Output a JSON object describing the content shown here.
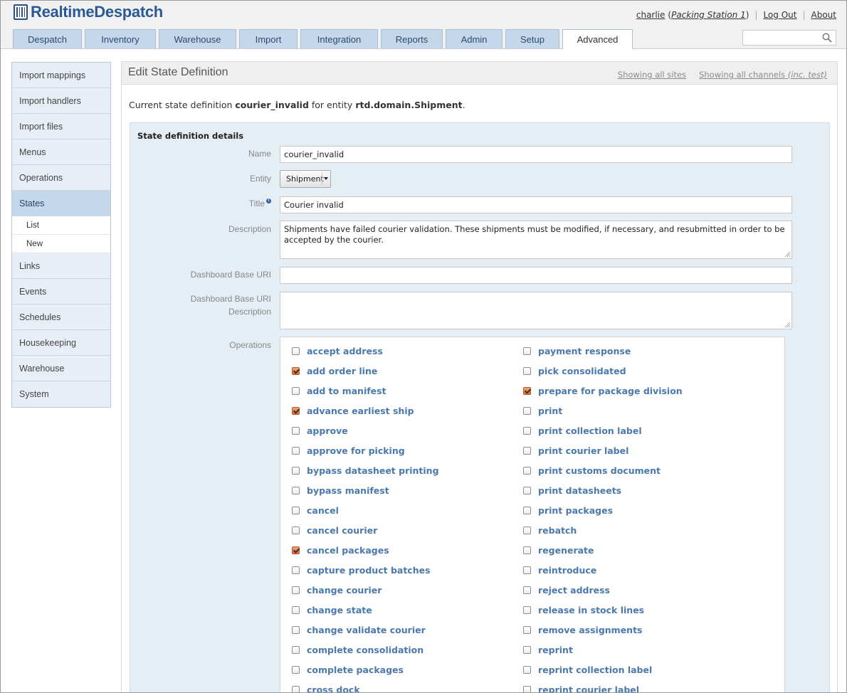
{
  "header": {
    "logo_text": "RealtimeDespatch",
    "user": "charlie",
    "station_open": "(",
    "station": "Packing Station 1",
    "station_close": ")",
    "logout": "Log Out",
    "about": "About",
    "search_placeholder": ""
  },
  "tabs": [
    {
      "label": "Despatch"
    },
    {
      "label": "Inventory"
    },
    {
      "label": "Warehouse"
    },
    {
      "label": "Import"
    },
    {
      "label": "Integration"
    },
    {
      "label": "Reports"
    },
    {
      "label": "Admin"
    },
    {
      "label": "Setup"
    },
    {
      "label": "Advanced"
    }
  ],
  "sidebar": {
    "items": [
      {
        "label": "Import mappings"
      },
      {
        "label": "Import handlers"
      },
      {
        "label": "Import files"
      },
      {
        "label": "Menus"
      },
      {
        "label": "Operations"
      },
      {
        "label": "States"
      },
      {
        "label": "Links"
      },
      {
        "label": "Events"
      },
      {
        "label": "Schedules"
      },
      {
        "label": "Housekeeping"
      },
      {
        "label": "Warehouse"
      },
      {
        "label": "System"
      }
    ],
    "sub_items": [
      {
        "label": "List"
      },
      {
        "label": "New"
      }
    ]
  },
  "main": {
    "title": "Edit State Definition",
    "showing_sites": "Showing all sites",
    "showing_channels": "Showing all channels",
    "showing_channels_note": "(inc. test)",
    "intro_prefix": "Current state definition ",
    "intro_name": "courier_invalid",
    "intro_mid": " for entity ",
    "intro_entity": "rtd.domain.Shipment",
    "intro_suffix": "."
  },
  "form": {
    "section_title": "State definition details",
    "name_label": "Name",
    "name_value": "courier_invalid",
    "entity_label": "Entity",
    "entity_value": "Shipment",
    "title_label": "Title",
    "title_value": "Courier invalid",
    "description_label": "Description",
    "description_value": "Shipments have failed courier validation. These shipments must be modified, if necessary, and resubmitted in order to be accepted by the courier.",
    "dashboard_uri_label": "Dashboard Base URI",
    "dashboard_uri_value": "",
    "dashboard_desc_label_1": "Dashboard Base URI",
    "dashboard_desc_label_2": "Description",
    "dashboard_desc_value": "",
    "operations_label": "Operations"
  },
  "operations_left": [
    {
      "label": "accept address",
      "checked": false
    },
    {
      "label": "add order line",
      "checked": true
    },
    {
      "label": "add to manifest",
      "checked": false
    },
    {
      "label": "advance earliest ship",
      "checked": true
    },
    {
      "label": "approve",
      "checked": false
    },
    {
      "label": "approve for picking",
      "checked": false
    },
    {
      "label": "bypass datasheet printing",
      "checked": false
    },
    {
      "label": "bypass manifest",
      "checked": false
    },
    {
      "label": "cancel",
      "checked": false
    },
    {
      "label": "cancel courier",
      "checked": false
    },
    {
      "label": "cancel packages",
      "checked": true
    },
    {
      "label": "capture product batches",
      "checked": false
    },
    {
      "label": "change courier",
      "checked": false
    },
    {
      "label": "change state",
      "checked": false
    },
    {
      "label": "change validate courier",
      "checked": false
    },
    {
      "label": "complete consolidation",
      "checked": false
    },
    {
      "label": "complete packages",
      "checked": false
    },
    {
      "label": "cross dock",
      "checked": false
    }
  ],
  "operations_right": [
    {
      "label": "payment response",
      "checked": false
    },
    {
      "label": "pick consolidated",
      "checked": false
    },
    {
      "label": "prepare for package division",
      "checked": true
    },
    {
      "label": "print",
      "checked": false
    },
    {
      "label": "print collection label",
      "checked": false
    },
    {
      "label": "print courier label",
      "checked": false
    },
    {
      "label": "print customs document",
      "checked": false
    },
    {
      "label": "print datasheets",
      "checked": false
    },
    {
      "label": "print packages",
      "checked": false
    },
    {
      "label": "rebatch",
      "checked": false
    },
    {
      "label": "regenerate",
      "checked": false
    },
    {
      "label": "reintroduce",
      "checked": false
    },
    {
      "label": "reject address",
      "checked": false
    },
    {
      "label": "release in stock lines",
      "checked": false
    },
    {
      "label": "remove assignments",
      "checked": false
    },
    {
      "label": "reprint",
      "checked": false
    },
    {
      "label": "reprint collection label",
      "checked": false
    },
    {
      "label": "reprint courier label",
      "checked": false
    }
  ]
}
